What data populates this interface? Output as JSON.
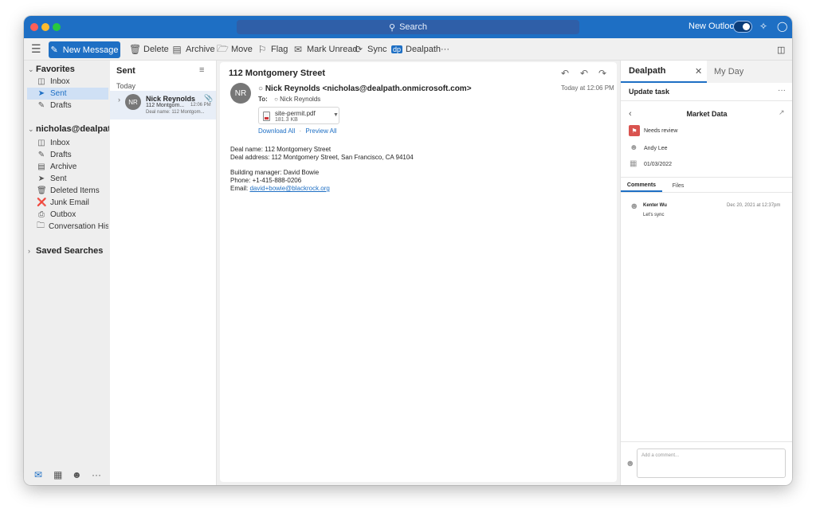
{
  "titlebar": {
    "search": "Search",
    "new_outlook": "New Outlook"
  },
  "toolbar": {
    "new_message": "New Message",
    "delete": "Delete",
    "archive": "Archive",
    "move": "Move",
    "flag": "Flag",
    "mark_unread": "Mark Unread",
    "sync": "Sync",
    "dealpath": "Dealpath",
    "more": "···"
  },
  "sidebar": {
    "favorites_title": "Favorites",
    "favorites": [
      {
        "label": "Inbox",
        "icon": "inbox-icon"
      },
      {
        "label": "Sent",
        "icon": "send-icon"
      },
      {
        "label": "Drafts",
        "icon": "drafts-icon"
      }
    ],
    "account_title": "nicholas@dealpath...",
    "account_items": [
      {
        "label": "Inbox"
      },
      {
        "label": "Drafts"
      },
      {
        "label": "Archive"
      },
      {
        "label": "Sent"
      },
      {
        "label": "Deleted Items"
      },
      {
        "label": "Junk Email"
      },
      {
        "label": "Outbox"
      },
      {
        "label": "Conversation His..."
      }
    ],
    "saved_searches": "Saved Searches"
  },
  "message_list": {
    "folder": "Sent",
    "group": "Today",
    "items": [
      {
        "initials": "NR",
        "sender": "Nick Reynolds",
        "subject": "112 Montgom...",
        "time": "12:06 PM",
        "preview": "Deal name: 112 Montgom..."
      }
    ]
  },
  "reading": {
    "subject": "112 Montgomery Street",
    "avatar": "NR",
    "sender": "Nick Reynolds <nicholas@dealpath.onmicrosoft.com>",
    "date": "Today at 12:06 PM",
    "to_label": "To:",
    "to": "Nick Reynolds",
    "attachment": {
      "name": "site-permit.pdf",
      "size": "181.3 KB"
    },
    "download_all": "Download All",
    "preview_all": "Preview All",
    "body": [
      "Deal name: 112 Montgomery Street",
      "Deal address: 112 Montgomery Street, San Francisco, CA 94104",
      "Building manager: David Bowie",
      "Phone: +1-415-888-0206",
      "Email: "
    ],
    "email_link": "david+bowie@blackrock.org"
  },
  "right_panel": {
    "tab_dealpath": "Dealpath",
    "tab_myday": "My Day",
    "update_task": "Update task",
    "more": "···",
    "market_data": "Market Data",
    "status": "Needs review",
    "assignee": "Andy Lee",
    "date": "01/03/2022",
    "tab_comments": "Comments",
    "tab_files": "Files",
    "comment": {
      "author": "Kenter Wu",
      "date": "Dec 20, 2021 at 12:37pm",
      "text": "Let's sync"
    },
    "add_comment_placeholder": "Add a comment..."
  },
  "colors": {
    "accent": "#1e6fc4",
    "flag_red": "#d9534f"
  }
}
